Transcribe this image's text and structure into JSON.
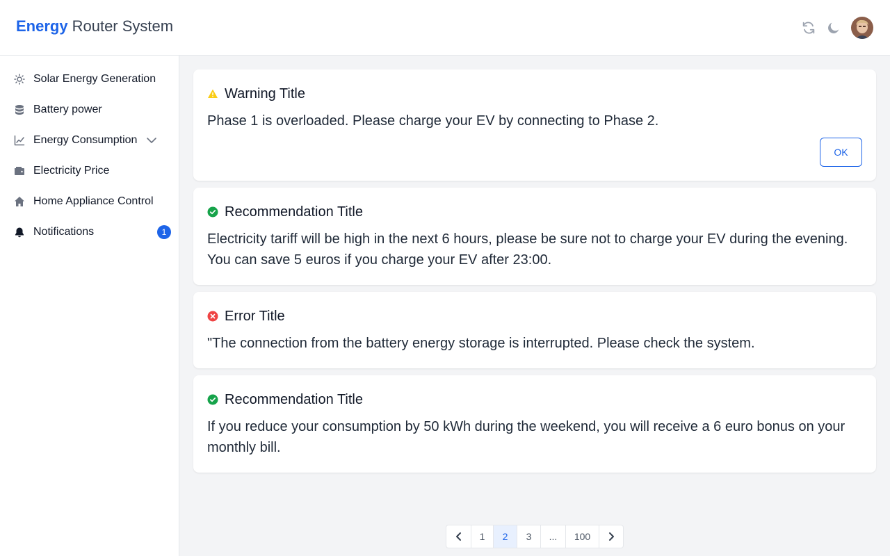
{
  "app": {
    "brand_bold": "Energy",
    "brand_rest": "Router System",
    "brand_color": "#1d64e8"
  },
  "header": {
    "actions": [
      {
        "icon": "refresh-icon"
      },
      {
        "icon": "moon-icon"
      },
      {
        "icon": "user-avatar"
      }
    ]
  },
  "sidebar": {
    "items": [
      {
        "label": "Solar Energy Generation",
        "icon": "sun-icon"
      },
      {
        "label": "Battery power",
        "icon": "database-icon"
      },
      {
        "label": "Energy Consumption",
        "icon": "chart-line-icon",
        "expandable": true
      },
      {
        "label": "Electricity Price",
        "icon": "wallet-icon"
      },
      {
        "label": "Home Appliance Control",
        "icon": "home-icon"
      },
      {
        "label": "Notifications",
        "icon": "bell-icon",
        "badge": "1"
      }
    ]
  },
  "notifications": [
    {
      "type": "warning",
      "title": "Warning Title",
      "message": "Phase 1 is overloaded. Please charge your EV by connecting to Phase 2.",
      "action_label": "OK",
      "color": "#facc15"
    },
    {
      "type": "success",
      "title": "Recommendation Title",
      "message": "Electricity tariff will be high in the next 6 hours, please be sure not to charge your EV during the evening. You can save 5 euros if you charge your EV after 23:00.",
      "color": "#16a34a"
    },
    {
      "type": "error",
      "title": "Error Title",
      "message": "\"The connection from the battery energy storage is interrupted. Please check the system.",
      "color": "#ef4444"
    },
    {
      "type": "success",
      "title": "Recommendation Title",
      "message": "If you reduce your consumption by 50 kWh during the weekend, you will receive a 6 euro bonus on your monthly bill.",
      "color": "#16a34a"
    }
  ],
  "pagination": {
    "pages": [
      "1",
      "2",
      "3",
      "...",
      "100"
    ],
    "current": "2"
  }
}
